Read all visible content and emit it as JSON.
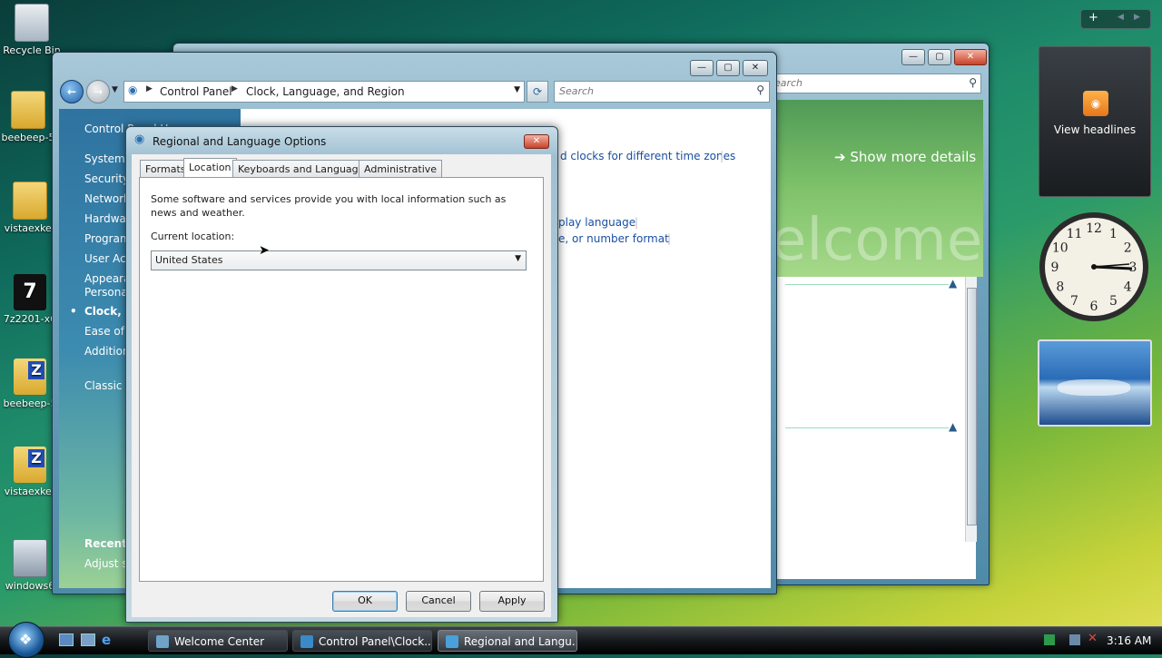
{
  "desktop_icons": [
    {
      "label": "Recycle Bin"
    },
    {
      "label": "beebeep-5"
    },
    {
      "label": "vistaexker"
    },
    {
      "label": "7z2201-x6"
    },
    {
      "label": "beebeep-5"
    },
    {
      "label": "vistaexker"
    },
    {
      "label": "windows6"
    }
  ],
  "back_window": {
    "search_placeholder": "Search",
    "banner_link": "Show more details",
    "banner_watermark": "elcome"
  },
  "control_panel": {
    "breadcrumb": [
      "Control Panel",
      "Clock, Language, and Region"
    ],
    "search_placeholder": "Search",
    "sidebar": {
      "home": "Control Panel Home",
      "items": [
        "System and Maintenance",
        "Security",
        "Network and Internet",
        "Hardware and Sound",
        "Programs",
        "User Accounts",
        "Appearance and",
        "Personalization",
        "Clock, Language, and Region",
        "Ease of Access",
        "Additional Options",
        "Classic View"
      ],
      "recent_header": "Recent Tasks",
      "recent_item": "Adjust screen resolution"
    },
    "content_links": {
      "link1": "d clocks for different time zones",
      "link2": "play language",
      "link3": "e, or number format"
    }
  },
  "dialog": {
    "title": "Regional and Language Options",
    "tabs": [
      "Formats",
      "Location",
      "Keyboards and Languages",
      "Administrative"
    ],
    "active_tab": "Location",
    "description": "Some software and services provide you with local information such as news and weather.",
    "current_location_label": "Current location:",
    "location_value": "United States",
    "buttons": {
      "ok": "OK",
      "cancel": "Cancel",
      "apply": "Apply"
    }
  },
  "gadgets": {
    "feed_label": "View headlines",
    "clock_numbers": [
      "12",
      "1",
      "2",
      "3",
      "4",
      "5",
      "6",
      "7",
      "8",
      "9",
      "10",
      "11"
    ],
    "clock_time": "3:16"
  },
  "taskbar": {
    "tasks": [
      "Welcome Center",
      "Control Panel\\Clock...",
      "Regional and Langu..."
    ],
    "clock": "3:16 AM"
  },
  "colors": {
    "accent": "#2f73a0",
    "link": "#1a4fa0",
    "taskbar": "#15181b"
  }
}
